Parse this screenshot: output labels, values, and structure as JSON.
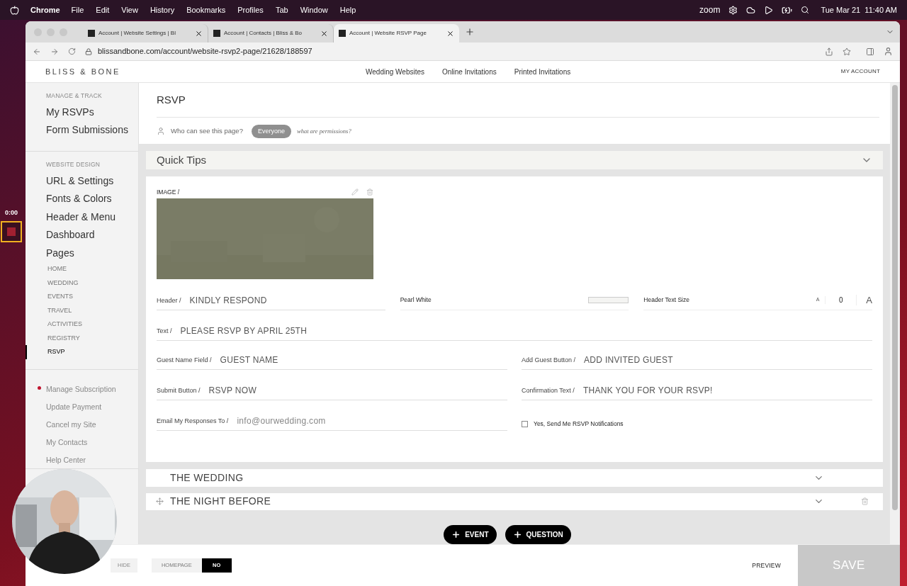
{
  "menubar": {
    "app": "Chrome",
    "menus": [
      "File",
      "Edit",
      "View",
      "History",
      "Bookmarks",
      "Profiles",
      "Tab",
      "Window",
      "Help"
    ],
    "zoom_label": "zoom",
    "clock": "Tue Mar 21  11:40 AM"
  },
  "recorder": {
    "time": "0:00"
  },
  "tabs": [
    {
      "title": "Account | Website Settings | Bl",
      "selected": false
    },
    {
      "title": "Account | Contacts | Bliss & Bo",
      "selected": false
    },
    {
      "title": "Account | Website RSVP Page",
      "selected": true
    }
  ],
  "address": "blissandbone.com/account/website-rsvp2-page/21628/188597",
  "site": {
    "logo": "BLISS & BONE",
    "nav": [
      "Wedding Websites",
      "Online Invitations",
      "Printed Invitations"
    ],
    "account": "MY ACCOUNT"
  },
  "sidebar": [
    {
      "heading": "MANAGE & TRACK",
      "items": [
        {
          "label": "My RSVPs",
          "kind": "primary"
        },
        {
          "label": "Form Submissions",
          "kind": "primary"
        }
      ]
    },
    {
      "heading": "WEBSITE DESIGN",
      "items": [
        {
          "label": "URL & Settings",
          "kind": "primary"
        },
        {
          "label": "Fonts & Colors",
          "kind": "primary"
        },
        {
          "label": "Header & Menu",
          "kind": "primary"
        },
        {
          "label": "Dashboard",
          "kind": "primary"
        },
        {
          "label": "Pages",
          "kind": "primary"
        },
        {
          "label": "HOME",
          "kind": "page",
          "selected": false
        },
        {
          "label": "WEDDING",
          "kind": "page",
          "selected": false
        },
        {
          "label": "EVENTS",
          "kind": "page",
          "selected": false
        },
        {
          "label": "TRAVEL",
          "kind": "page",
          "selected": false
        },
        {
          "label": "ACTIVITIES",
          "kind": "page",
          "selected": false
        },
        {
          "label": "REGISTRY",
          "kind": "page",
          "selected": false
        },
        {
          "label": "RSVP",
          "kind": "page",
          "selected": true
        }
      ]
    },
    {
      "items": [
        {
          "label": "Manage Subscription",
          "kind": "link",
          "alert": true
        },
        {
          "label": "Update Payment",
          "kind": "link",
          "alert": false
        },
        {
          "label": "Cancel my Site",
          "kind": "link",
          "alert": false
        },
        {
          "label": "My Contacts",
          "kind": "link",
          "alert": false
        },
        {
          "label": "Help Center",
          "kind": "link",
          "alert": false
        }
      ]
    }
  ],
  "page": {
    "title": "RSVP",
    "permission_label": "Who can see this page?",
    "permission_value": "Everyone",
    "permission_help": "what are permissions?"
  },
  "quick_tips": {
    "title": "Quick Tips",
    "expanded": false
  },
  "form": {
    "image_label": "IMAGE /",
    "header": {
      "label": "Header /",
      "value": "KINDLY RESPOND"
    },
    "header_color": {
      "name": "Pearl White",
      "color": "#f4f4f2"
    },
    "header_size": {
      "label": "Header Text Size",
      "small": "A",
      "value": "0",
      "large": "A"
    },
    "text": {
      "label": "Text /",
      "value": "PLEASE RSVP BY APRIL 25TH"
    },
    "fields": [
      {
        "label": "Guest Name Field /",
        "value": "GUEST NAME"
      },
      {
        "label": "Add Guest Button /",
        "value": "ADD INVITED GUEST"
      },
      {
        "label": "Submit Button /",
        "value": "RSVP NOW"
      },
      {
        "label": "Confirmation Text /",
        "value": "THANK YOU FOR YOUR RSVP!"
      },
      {
        "label": "Email My Responses To /",
        "placeholder": "info@ourwedding.com"
      }
    ],
    "notify": {
      "label": "Yes, Send Me RSVP Notifications",
      "checked": false
    }
  },
  "events": [
    {
      "title": "THE WEDDING",
      "draggable": false,
      "deletable": false
    },
    {
      "title": "THE NIGHT BEFORE",
      "draggable": true,
      "deletable": true
    }
  ],
  "add_buttons": [
    "EVENT",
    "QUESTION"
  ],
  "bottom": {
    "visibility": [
      {
        "label": "HIDE",
        "selected": false
      }
    ],
    "homepage_label": "HOMEPAGE",
    "homepage_value": "NO",
    "preview": "PREVIEW",
    "save": "SAVE"
  }
}
